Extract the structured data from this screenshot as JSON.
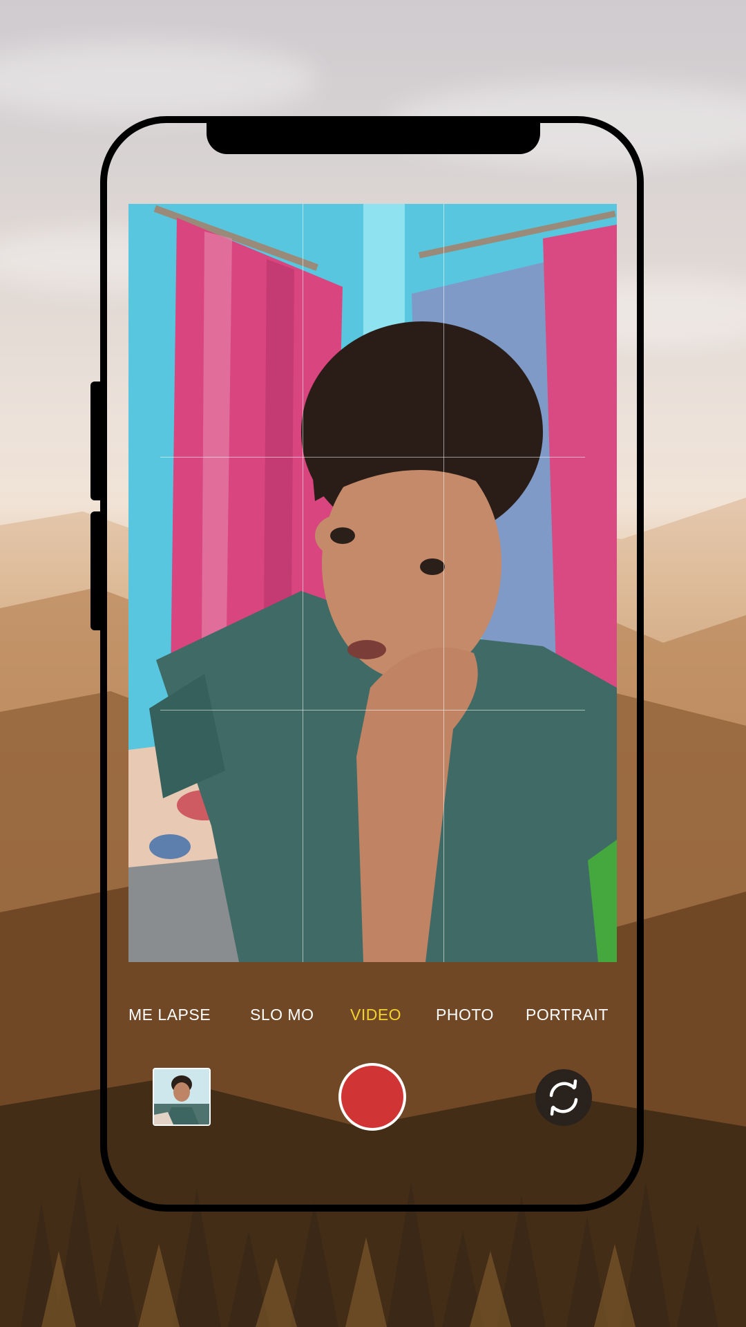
{
  "camera": {
    "modes": [
      {
        "label": "ME LAPSE",
        "active": false
      },
      {
        "label": "SLO MO",
        "active": false
      },
      {
        "label": "VIDEO",
        "active": true
      },
      {
        "label": "PHOTO",
        "active": false
      },
      {
        "label": "PORTRAIT",
        "active": false
      }
    ],
    "active_mode": "VIDEO",
    "icons": {
      "shutter": "record-button-icon",
      "flip": "flip-camera-icon",
      "gallery": "last-photo-thumbnail"
    },
    "colors": {
      "active_mode": "#f2d230",
      "record": "#d03434",
      "frame": "#000000"
    },
    "grid": "3x3"
  }
}
